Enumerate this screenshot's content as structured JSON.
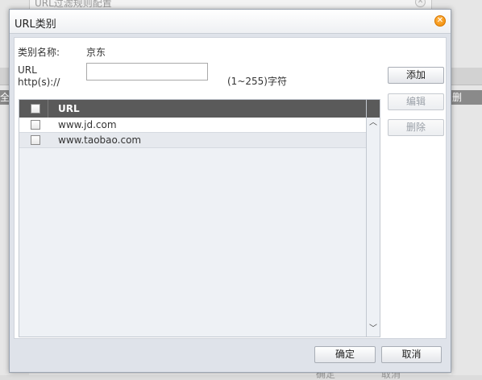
{
  "background": {
    "title": "URL过滤规则配置",
    "left_text": "全",
    "right_text": "删",
    "ok_label": "确定",
    "cancel_label": "取消"
  },
  "dialog": {
    "title": "URL类别",
    "category_label": "类别名称:",
    "category_value": "京东",
    "url_label_line1": "URL",
    "url_label_line2": "http(s)://",
    "url_input_value": "",
    "url_hint": "(1~255)字符",
    "add_button": "添加",
    "edit_button": "编辑",
    "delete_button": "删除",
    "table": {
      "column_url": "URL",
      "rows": [
        {
          "url": "www.jd.com"
        },
        {
          "url": "www.taobao.com"
        }
      ]
    },
    "ok_button": "确定",
    "cancel_button": "取消"
  },
  "colors": {
    "header_bg": "#5a5a5a",
    "dialog_bg": "#dfe3ea",
    "close_icon": "#f08a00"
  }
}
